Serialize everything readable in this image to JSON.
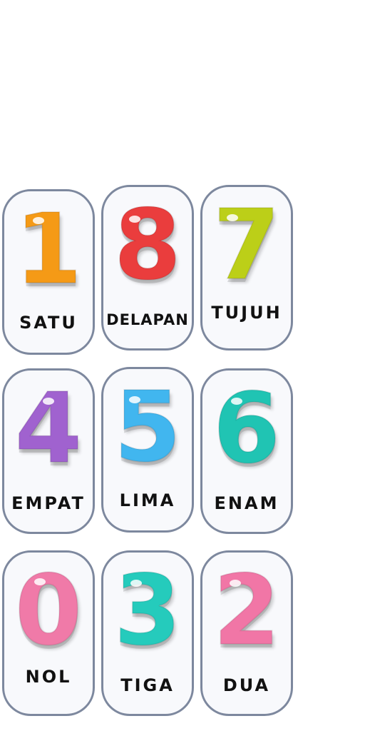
{
  "cards": [
    {
      "digit": "1",
      "word": "SATU",
      "color": "#f59a16"
    },
    {
      "digit": "8",
      "word": "DELAPAN",
      "color": "#ea3d3d"
    },
    {
      "digit": "7",
      "word": "TUJUH",
      "color": "#bccf18"
    },
    {
      "digit": "4",
      "word": "EMPAT",
      "color": "#a062cf"
    },
    {
      "digit": "5",
      "word": "LIMA",
      "color": "#41b6ef"
    },
    {
      "digit": "6",
      "word": "ENAM",
      "color": "#20c4b3"
    },
    {
      "digit": "0",
      "word": "NOL",
      "color": "#f07aa8"
    },
    {
      "digit": "3",
      "word": "TIGA",
      "color": "#25cbbc"
    },
    {
      "digit": "2",
      "word": "DUA",
      "color": "#f176a6"
    }
  ]
}
